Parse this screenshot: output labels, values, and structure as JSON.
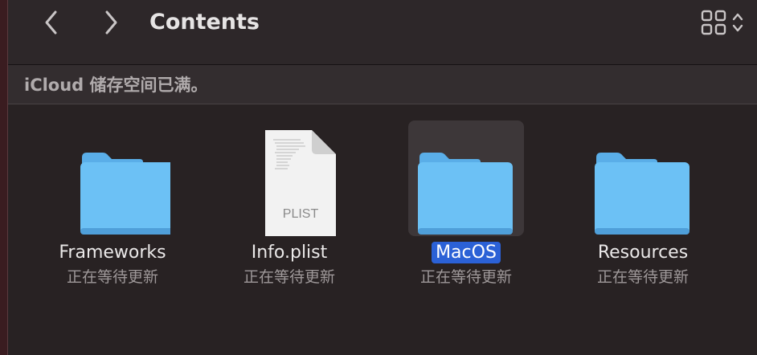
{
  "window": {
    "title": "Contents"
  },
  "toolbar": {
    "back_icon": "chevron-left-icon",
    "forward_icon": "chevron-right-icon",
    "view_icon": "grid-view-icon",
    "view_toggle_icon": "chevron-updown-icon"
  },
  "banner": {
    "text": "iCloud 储存空间已满。"
  },
  "items": [
    {
      "name": "Frameworks",
      "status": "正在等待更新",
      "icon": "folder-icon",
      "selected": false
    },
    {
      "name": "Info.plist",
      "status": "正在等待更新",
      "icon": "plist-file-icon",
      "badge": "PLIST",
      "selected": false
    },
    {
      "name": "MacOS",
      "status": "正在等待更新",
      "icon": "folder-icon",
      "selected": true
    },
    {
      "name": "Resources",
      "status": "正在等待更新",
      "icon": "folder-icon",
      "selected": false
    }
  ],
  "colors": {
    "folder_body": "#6cc1f5",
    "folder_tab": "#5aaee8",
    "selection": "#2b61d6",
    "background": "#282223"
  }
}
